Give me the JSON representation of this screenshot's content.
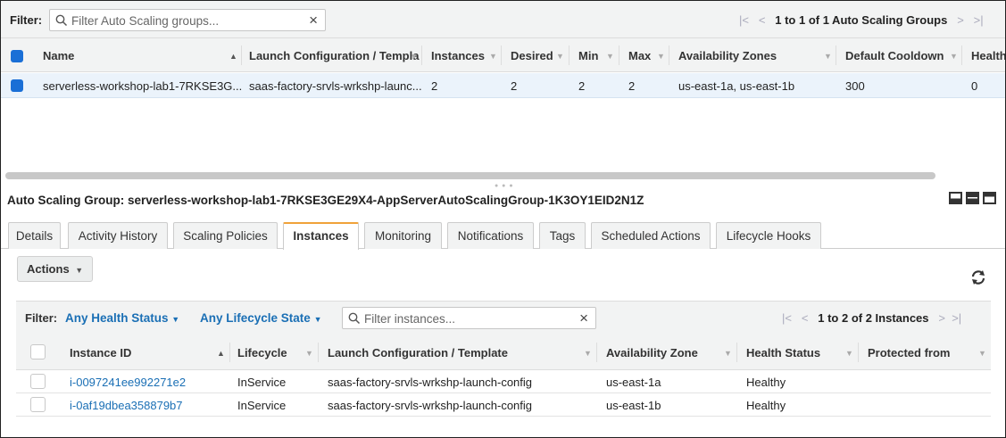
{
  "filter_bar": {
    "label": "Filter:",
    "search_placeholder": "Filter Auto Scaling groups...",
    "pager_text": "1 to 1 of 1 Auto Scaling Groups"
  },
  "asg_table": {
    "columns": [
      "Name",
      "Launch Configuration / Templa",
      "Instances",
      "Desired",
      "Min",
      "Max",
      "Availability Zones",
      "Default Cooldown",
      "Health"
    ],
    "rows": [
      {
        "name": "serverless-workshop-lab1-7RKSE3G...",
        "launch_config": "saas-factory-srvls-wrkshp-launc...",
        "instances": "2",
        "desired": "2",
        "min": "2",
        "max": "2",
        "azs": "us-east-1a, us-east-1b",
        "cooldown": "300",
        "health": "0"
      }
    ]
  },
  "detail": {
    "title": "Auto Scaling Group: serverless-workshop-lab1-7RKSE3GE29X4-AppServerAutoScalingGroup-1K3OY1EID2N1Z",
    "tabs": [
      "Details",
      "Activity History",
      "Scaling Policies",
      "Instances",
      "Monitoring",
      "Notifications",
      "Tags",
      "Scheduled Actions",
      "Lifecycle Hooks"
    ],
    "active_tab": "Instances",
    "actions_label": "Actions",
    "instances_filter": {
      "label": "Filter:",
      "health_dropdown": "Any Health Status",
      "lifecycle_dropdown": "Any Lifecycle State",
      "search_placeholder": "Filter instances...",
      "pager_text": "1 to 2 of 2 Instances"
    },
    "instances_table": {
      "columns": [
        "Instance ID",
        "Lifecycle",
        "Launch Configuration / Template",
        "Availability Zone",
        "Health Status",
        "Protected from"
      ],
      "rows": [
        {
          "id": "i-0097241ee992271e2",
          "lifecycle": "InService",
          "launch_config": "saas-factory-srvls-wrkshp-launch-config",
          "az": "us-east-1a",
          "health": "Healthy"
        },
        {
          "id": "i-0af19dbea358879b7",
          "lifecycle": "InService",
          "launch_config": "saas-factory-srvls-wrkshp-launch-config",
          "az": "us-east-1b",
          "health": "Healthy"
        }
      ]
    }
  },
  "colors": {
    "accent_blue": "#1a6fb5",
    "selected_row": "#ebf3fb",
    "active_tab_border": "#f0a23a"
  }
}
